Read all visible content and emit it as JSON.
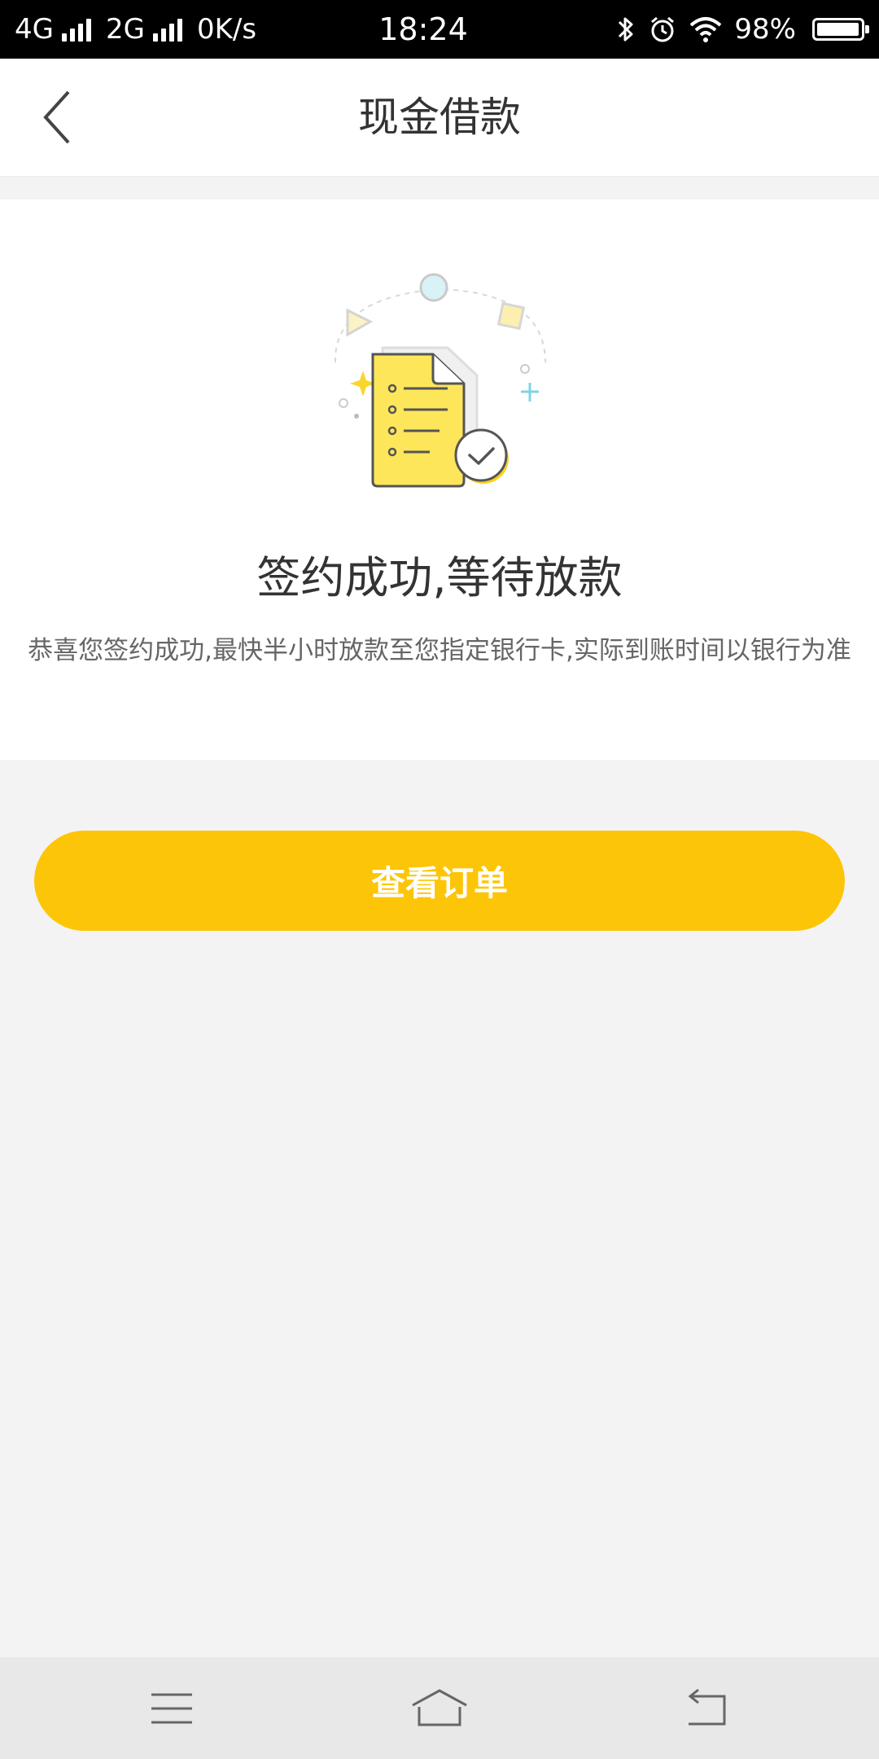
{
  "status_bar": {
    "network_1": "4G",
    "network_2": "2G",
    "speed": "0K/s",
    "time": "18:24",
    "battery": "98%",
    "battery_level": 0.98,
    "icons": [
      "bluetooth-icon",
      "alarm-icon",
      "wifi-icon",
      "battery-icon"
    ]
  },
  "header": {
    "title": "现金借款"
  },
  "result": {
    "title": "签约成功,等待放款",
    "description": "恭喜您签约成功,最快半小时放款至您指定银行卡,实际到账时间以银行为准"
  },
  "actions": {
    "view_order_label": "查看订单"
  },
  "colors": {
    "accent": "#fdc507",
    "background": "#f3f3f4",
    "text_primary": "#333333",
    "text_secondary": "#666666"
  },
  "system_nav": {
    "icons": [
      "menu-icon",
      "home-icon",
      "back-icon"
    ]
  }
}
